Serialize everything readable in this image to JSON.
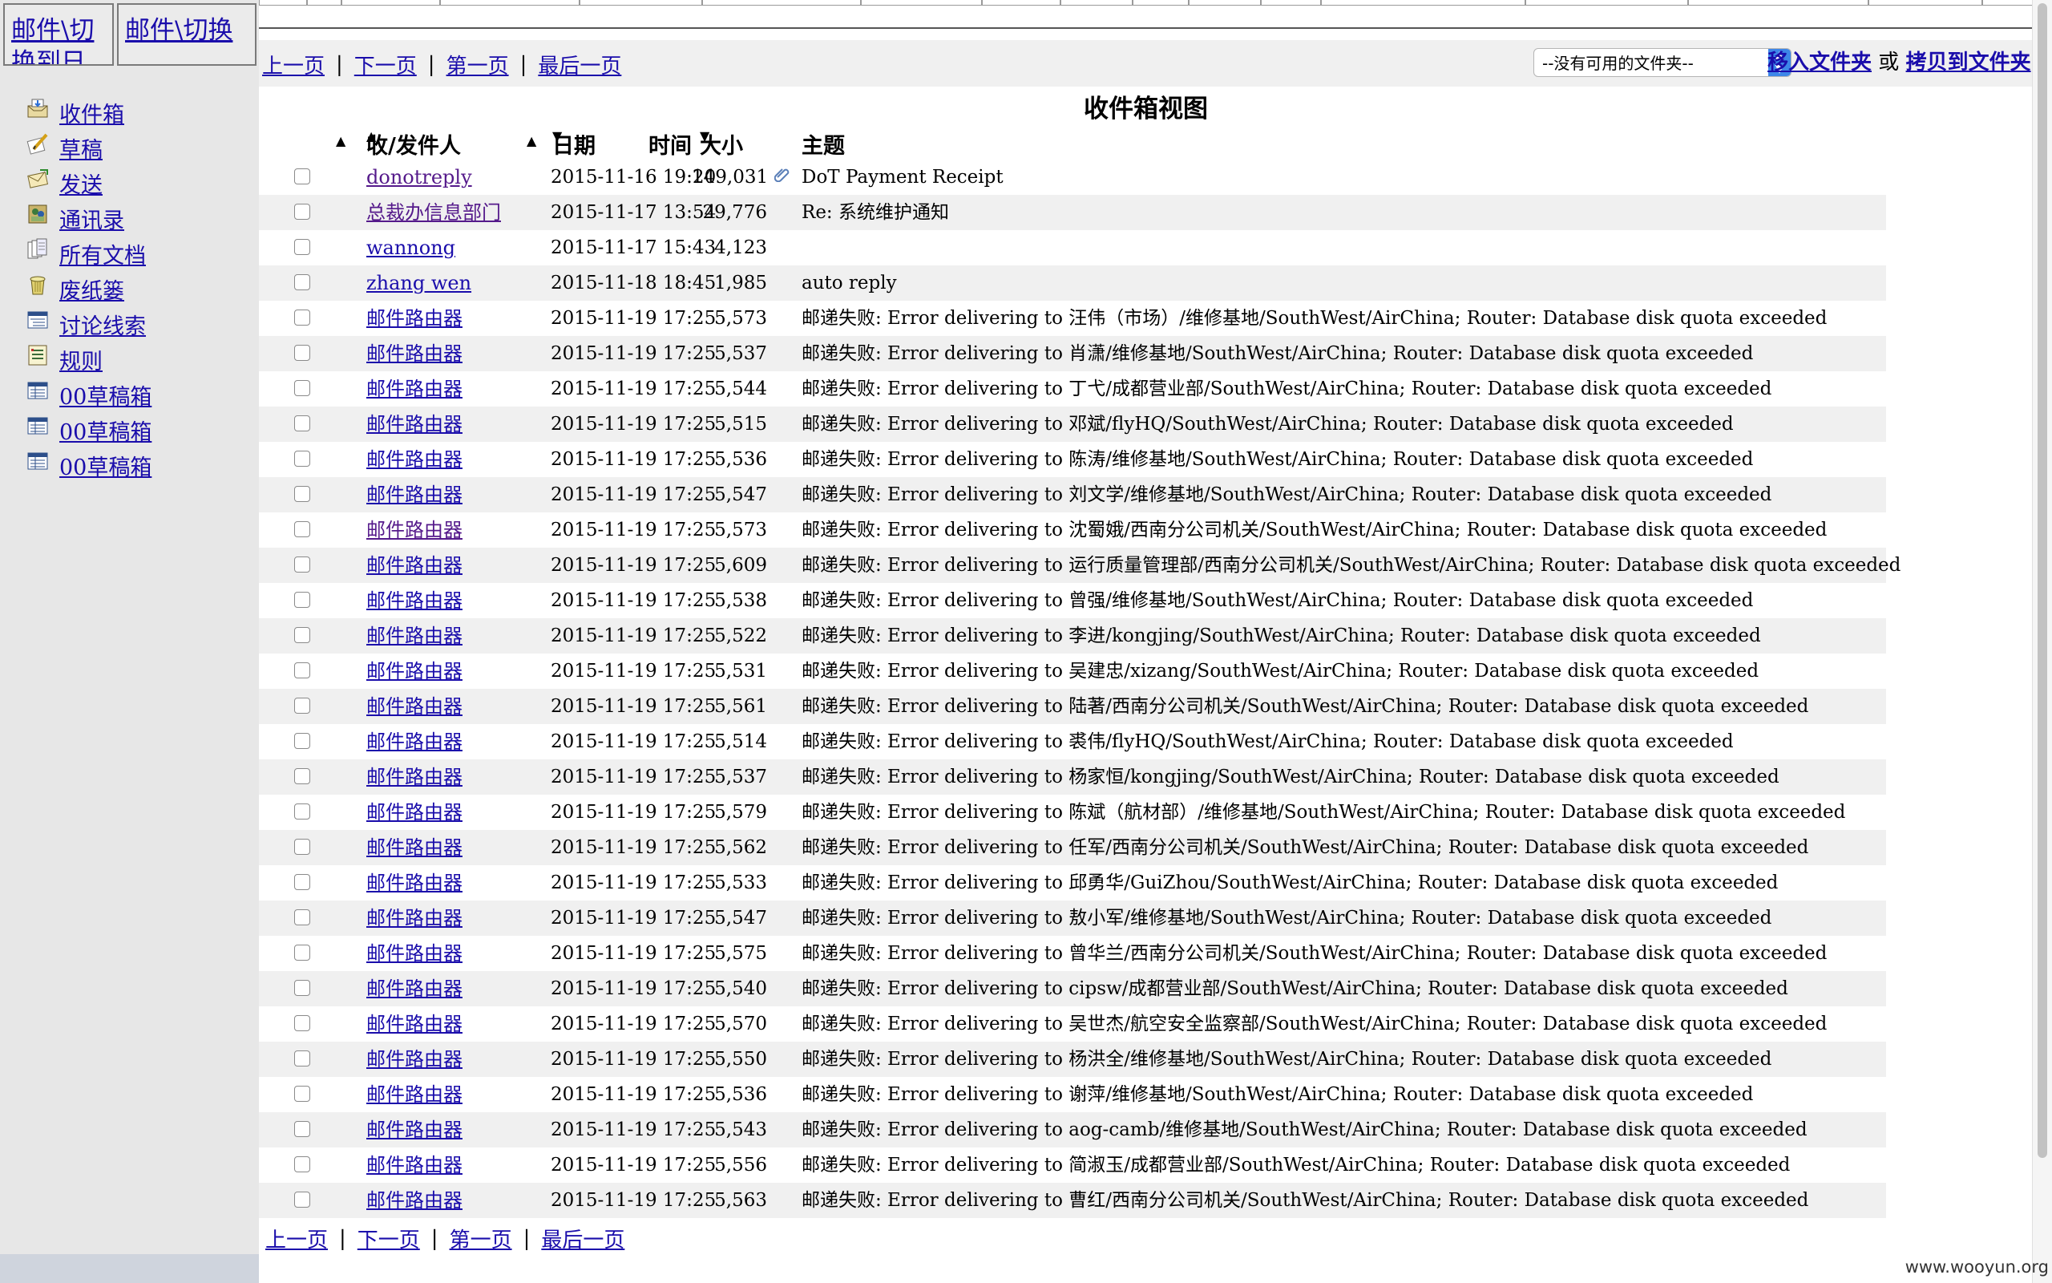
{
  "left": {
    "switch1": "邮件\\切换到日",
    "switch2": "邮件\\切换",
    "nav": [
      {
        "icon": "inbox-icon",
        "label": "收件箱"
      },
      {
        "icon": "draft-icon",
        "label": "草稿"
      },
      {
        "icon": "sent-icon",
        "label": "发送"
      },
      {
        "icon": "contacts-icon",
        "label": "通讯录"
      },
      {
        "icon": "all-docs-icon",
        "label": "所有文档"
      },
      {
        "icon": "trash-icon",
        "label": "废纸篓"
      },
      {
        "icon": "threads-icon",
        "label": "讨论线索"
      },
      {
        "icon": "rules-icon",
        "label": "规则"
      },
      {
        "icon": "folder-view-icon",
        "label": "00草稿箱"
      },
      {
        "icon": "folder-view-icon",
        "label": "00草稿箱"
      },
      {
        "icon": "folder-view-icon",
        "label": "00草稿箱"
      }
    ]
  },
  "pager": {
    "prev": "上一页",
    "next": "下一页",
    "first": "第一页",
    "last": "最后一页",
    "sep": "|"
  },
  "folder": {
    "select_value": "--没有可用的文件夹--",
    "move": "移入文件夹",
    "or": "或",
    "copy": "拷贝到文件夹"
  },
  "view_title": "收件箱视图",
  "columns": {
    "from": "收/发件人",
    "date": "日期",
    "time": "时间",
    "size": "大小",
    "subject": "主题"
  },
  "messages": [
    {
      "from": "donotreply",
      "datetime": "2015-11-16 19:20",
      "size": "149,031",
      "attachment": true,
      "subject": "DoT Payment Receipt",
      "visited": true
    },
    {
      "from": "总裁办信息部门",
      "datetime": "2015-11-17 13:54",
      "size": "29,776",
      "subject": "Re: 系统维护通知",
      "visited": true
    },
    {
      "from": "wannong",
      "datetime": "2015-11-17 15:43",
      "size": "4,123",
      "subject": ""
    },
    {
      "from": "zhang wen",
      "datetime": "2015-11-18 18:45",
      "size": "1,985",
      "subject": "auto reply"
    },
    {
      "from": "邮件路由器",
      "datetime": "2015-11-19 17:25",
      "size": "5,573",
      "subject": "邮递失败: Error delivering to 汪伟（市场）/维修基地/SouthWest/AirChina; Router: Database disk quota exceeded"
    },
    {
      "from": "邮件路由器",
      "datetime": "2015-11-19 17:25",
      "size": "5,537",
      "subject": "邮递失败: Error delivering to 肖潇/维修基地/SouthWest/AirChina; Router: Database disk quota exceeded"
    },
    {
      "from": "邮件路由器",
      "datetime": "2015-11-19 17:25",
      "size": "5,544",
      "subject": "邮递失败: Error delivering to 丁弋/成都营业部/SouthWest/AirChina; Router: Database disk quota exceeded"
    },
    {
      "from": "邮件路由器",
      "datetime": "2015-11-19 17:25",
      "size": "5,515",
      "subject": "邮递失败: Error delivering to 邓斌/flyHQ/SouthWest/AirChina; Router: Database disk quota exceeded"
    },
    {
      "from": "邮件路由器",
      "datetime": "2015-11-19 17:25",
      "size": "5,536",
      "subject": "邮递失败: Error delivering to 陈涛/维修基地/SouthWest/AirChina; Router: Database disk quota exceeded"
    },
    {
      "from": "邮件路由器",
      "datetime": "2015-11-19 17:25",
      "size": "5,547",
      "subject": "邮递失败: Error delivering to 刘文学/维修基地/SouthWest/AirChina; Router: Database disk quota exceeded"
    },
    {
      "from": "邮件路由器",
      "datetime": "2015-11-19 17:25",
      "size": "5,573",
      "subject": "邮递失败: Error delivering to 沈蜀娥/西南分公司机关/SouthWest/AirChina; Router: Database disk quota exceeded",
      "visited": true
    },
    {
      "from": "邮件路由器",
      "datetime": "2015-11-19 17:25",
      "size": "5,609",
      "subject": "邮递失败: Error delivering to 运行质量管理部/西南分公司机关/SouthWest/AirChina; Router: Database disk quota exceeded"
    },
    {
      "from": "邮件路由器",
      "datetime": "2015-11-19 17:25",
      "size": "5,538",
      "subject": "邮递失败: Error delivering to 曾强/维修基地/SouthWest/AirChina; Router: Database disk quota exceeded"
    },
    {
      "from": "邮件路由器",
      "datetime": "2015-11-19 17:25",
      "size": "5,522",
      "subject": "邮递失败: Error delivering to 李进/kongjing/SouthWest/AirChina; Router: Database disk quota exceeded"
    },
    {
      "from": "邮件路由器",
      "datetime": "2015-11-19 17:25",
      "size": "5,531",
      "subject": "邮递失败: Error delivering to 吴建忠/xizang/SouthWest/AirChina; Router: Database disk quota exceeded"
    },
    {
      "from": "邮件路由器",
      "datetime": "2015-11-19 17:25",
      "size": "5,561",
      "subject": "邮递失败: Error delivering to 陆著/西南分公司机关/SouthWest/AirChina; Router: Database disk quota exceeded"
    },
    {
      "from": "邮件路由器",
      "datetime": "2015-11-19 17:25",
      "size": "5,514",
      "subject": "邮递失败: Error delivering to 裘伟/flyHQ/SouthWest/AirChina; Router: Database disk quota exceeded"
    },
    {
      "from": "邮件路由器",
      "datetime": "2015-11-19 17:25",
      "size": "5,537",
      "subject": "邮递失败: Error delivering to 杨家恒/kongjing/SouthWest/AirChina; Router: Database disk quota exceeded"
    },
    {
      "from": "邮件路由器",
      "datetime": "2015-11-19 17:25",
      "size": "5,579",
      "subject": "邮递失败: Error delivering to 陈斌（航材部）/维修基地/SouthWest/AirChina; Router: Database disk quota exceeded"
    },
    {
      "from": "邮件路由器",
      "datetime": "2015-11-19 17:25",
      "size": "5,562",
      "subject": "邮递失败: Error delivering to 任军/西南分公司机关/SouthWest/AirChina; Router: Database disk quota exceeded"
    },
    {
      "from": "邮件路由器",
      "datetime": "2015-11-19 17:25",
      "size": "5,533",
      "subject": "邮递失败: Error delivering to 邱勇华/GuiZhou/SouthWest/AirChina; Router: Database disk quota exceeded"
    },
    {
      "from": "邮件路由器",
      "datetime": "2015-11-19 17:25",
      "size": "5,547",
      "subject": "邮递失败: Error delivering to 敖小军/维修基地/SouthWest/AirChina; Router: Database disk quota exceeded"
    },
    {
      "from": "邮件路由器",
      "datetime": "2015-11-19 17:25",
      "size": "5,575",
      "subject": "邮递失败: Error delivering to 曾华兰/西南分公司机关/SouthWest/AirChina; Router: Database disk quota exceeded"
    },
    {
      "from": "邮件路由器",
      "datetime": "2015-11-19 17:25",
      "size": "5,540",
      "subject": "邮递失败: Error delivering to cipsw/成都营业部/SouthWest/AirChina; Router: Database disk quota exceeded"
    },
    {
      "from": "邮件路由器",
      "datetime": "2015-11-19 17:25",
      "size": "5,570",
      "subject": "邮递失败: Error delivering to 吴世杰/航空安全监察部/SouthWest/AirChina; Router: Database disk quota exceeded"
    },
    {
      "from": "邮件路由器",
      "datetime": "2015-11-19 17:25",
      "size": "5,550",
      "subject": "邮递失败: Error delivering to 杨洪全/维修基地/SouthWest/AirChina; Router: Database disk quota exceeded"
    },
    {
      "from": "邮件路由器",
      "datetime": "2015-11-19 17:25",
      "size": "5,536",
      "subject": "邮递失败: Error delivering to 谢萍/维修基地/SouthWest/AirChina; Router: Database disk quota exceeded"
    },
    {
      "from": "邮件路由器",
      "datetime": "2015-11-19 17:25",
      "size": "5,543",
      "subject": "邮递失败: Error delivering to aog-camb/维修基地/SouthWest/AirChina; Router: Database disk quota exceeded"
    },
    {
      "from": "邮件路由器",
      "datetime": "2015-11-19 17:25",
      "size": "5,556",
      "subject": "邮递失败: Error delivering to 简淑玉/成都营业部/SouthWest/AirChina; Router: Database disk quota exceeded"
    },
    {
      "from": "邮件路由器",
      "datetime": "2015-11-19 17:25",
      "size": "5,563",
      "subject": "邮递失败: Error delivering to 曹红/西南分公司机关/SouthWest/AirChina; Router: Database disk quota exceeded"
    }
  ],
  "watermark": "www.wooyun.org",
  "colors": {
    "link": "#1a0dab",
    "visited": "#551a8b",
    "alt_row": "#f0f0f0",
    "sidebar": "#e7e7e7",
    "select_accent": "#3d86e8"
  }
}
